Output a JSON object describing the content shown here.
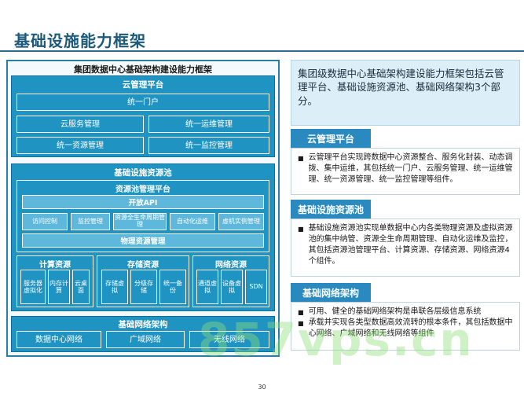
{
  "slide": {
    "title": "基础设施能力框架",
    "page_number": "30"
  },
  "diagram": {
    "title": "集团数据中心基础架构建设能力框架",
    "cloud": {
      "title": "云管理平台",
      "portal": "统一门户",
      "items": [
        "云服务管理",
        "统一运维管理",
        "统一资源管理",
        "统一监控管理"
      ]
    },
    "pool": {
      "title": "基础设施资源池",
      "platform": {
        "title": "资源池管理平台",
        "open_api": "开放API",
        "modules": [
          "访问控制",
          "监控管理",
          "资源全生命周期管理",
          "自动化运维",
          "虚机实例管理"
        ],
        "physical": "物理资源管理"
      },
      "compute": {
        "title": "计算资源",
        "items": [
          "服务器虚拟化",
          "内存计算",
          "云桌面"
        ]
      },
      "storage": {
        "title": "存储资源",
        "items": [
          "存储虚拟",
          "分级存储",
          "统一备份"
        ]
      },
      "network": {
        "title": "网络资源",
        "items": [
          "通道虚拟",
          "设备虚拟",
          "SDN"
        ]
      }
    },
    "net": {
      "title": "基础网络架构",
      "items": [
        "数据中心网络",
        "广域网络",
        "无线网络"
      ]
    }
  },
  "summary": "集团级数据中心基础架构建设能力框架包括云管理平台、基础设施资源池、基础网络架构3个部分。",
  "sections": [
    {
      "heading": "云管理平台",
      "bullets": [
        "云管理平台实现跨数据中心资源整合、服务化封装、动态调拨、集中运维，其包括统一门户、云服务管理、统一运维管理、统一资源管理、统一监控管理等组件。"
      ]
    },
    {
      "heading": "基础设施资源池",
      "bullets": [
        "基础设施资源池实现单数据中心内各类物理资源及虚拟资源池的集中纳管、资源全生命周期管理、自动化运维及监控，其包括资源池管理平台、计算资源、存储资源、网络资源4个组件。"
      ]
    },
    {
      "heading": "基础网络架构",
      "bullets": [
        "可用、健全的基础网络架构是串联各层级信息系统",
        "承载并实现各类型数据高效流转的根本条件，其包括数据中心网络、广域网络和无线网络等组件"
      ]
    }
  ],
  "watermark": "857vps.cn",
  "colors": {
    "accent": "#1f93c2",
    "heading_blue": "#2a8ac0",
    "title_blue": "#1b5a7a",
    "summary_bg": "#dceef7"
  }
}
